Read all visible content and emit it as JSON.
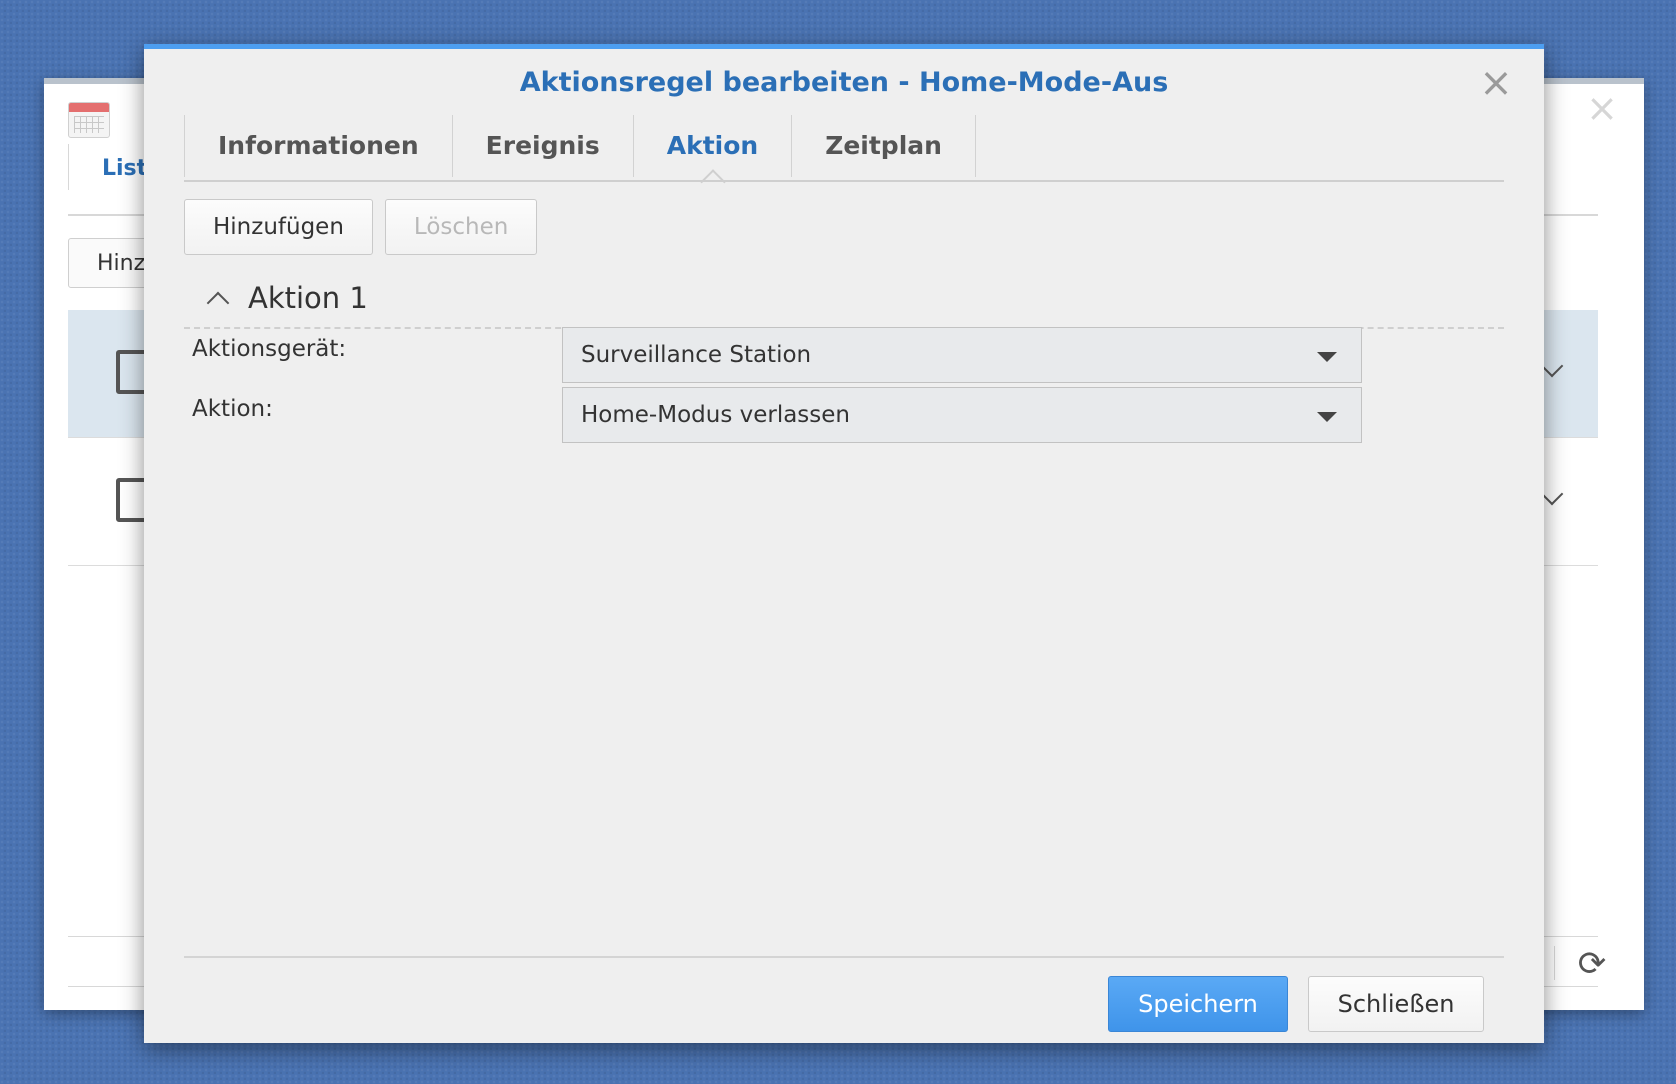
{
  "background_window": {
    "tab_label": "List",
    "add_button_label": "Hinz",
    "close_glyph": "×",
    "refresh_glyph": "⟳"
  },
  "dialog": {
    "title": "Aktionsregel bearbeiten - Home-Mode-Aus",
    "close_glyph": "×",
    "tabs": [
      {
        "label": "Informationen",
        "active": false
      },
      {
        "label": "Ereignis",
        "active": false
      },
      {
        "label": "Aktion",
        "active": true
      },
      {
        "label": "Zeitplan",
        "active": false
      }
    ],
    "toolbar": {
      "add_label": "Hinzufügen",
      "delete_label": "Löschen",
      "delete_enabled": false
    },
    "section": {
      "title": "Aktion 1",
      "expanded": true
    },
    "form": {
      "device_label": "Aktionsgerät:",
      "device_value": "Surveillance Station",
      "action_label": "Aktion:",
      "action_value": "Home-Modus verlassen"
    },
    "footer": {
      "save_label": "Speichern",
      "close_label": "Schließen"
    }
  },
  "colors": {
    "desktop": "#4a73b2",
    "accent": "#2b6fb6",
    "primary_button": "#4d9ef0",
    "dialog_background": "#efefef"
  },
  "icons": {
    "app": "calendar-app-icon",
    "row": "calendar-icon",
    "expand": "chevron-down-icon",
    "collapse": "chevron-up-icon",
    "dropdown": "caret-down-icon",
    "close": "close-icon",
    "refresh": "refresh-icon"
  }
}
